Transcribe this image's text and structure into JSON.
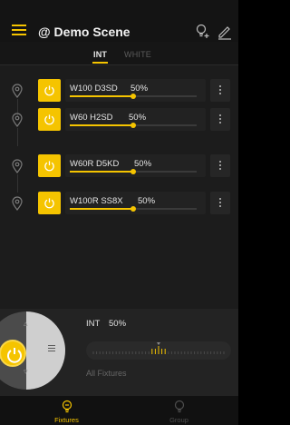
{
  "header": {
    "scene_title": "@ Demo Scene",
    "menu_icon": "hamburger-menu-icon",
    "add_fixture_icon": "bulb-plus-icon",
    "edit_icon": "pencil-icon"
  },
  "mode_tabs": [
    {
      "label": "INT",
      "active": true
    },
    {
      "label": "WHITE",
      "active": false
    }
  ],
  "fixtures": [
    {
      "name": "W100 D3SD",
      "level_text": "50%",
      "level": 0.5,
      "power": "on"
    },
    {
      "name": "W60 H2SD",
      "level_text": "50%",
      "level": 0.5,
      "power": "on"
    },
    {
      "name": "W60R D5KD",
      "level_text": "50%",
      "level": 0.5,
      "power": "on"
    },
    {
      "name": "W100R SS8X",
      "level_text": "50%",
      "level": 0.5,
      "power": "on"
    }
  ],
  "control_panel": {
    "mode_label": "INT",
    "level_text": "50%",
    "level": 0.5,
    "target_label": "All Fixtures"
  },
  "bottom_nav": [
    {
      "label": "Fixtures",
      "active": true,
      "icon": "bulb-icon"
    },
    {
      "label": "Group",
      "active": false,
      "icon": "bulb-group-icon"
    }
  ],
  "colors": {
    "accent": "#f5c400",
    "background": "#1c1c1c"
  }
}
